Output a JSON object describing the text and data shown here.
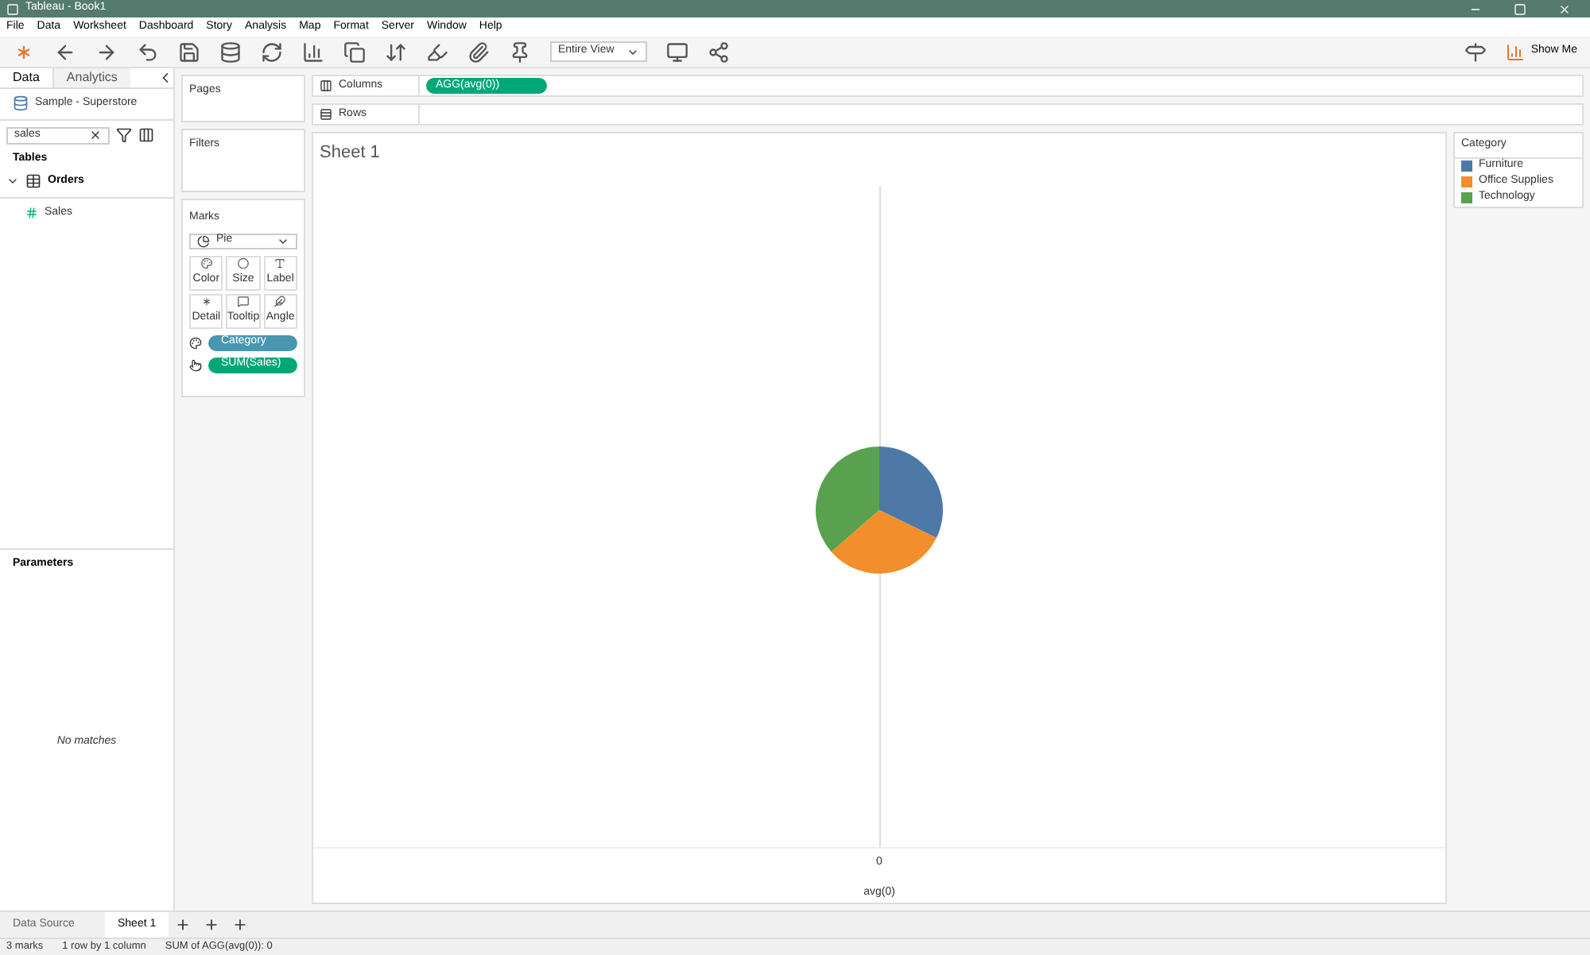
{
  "window": {
    "title": "Tableau - Book1"
  },
  "menu": [
    "File",
    "Data",
    "Worksheet",
    "Dashboard",
    "Story",
    "Analysis",
    "Map",
    "Format",
    "Server",
    "Window",
    "Help"
  ],
  "toolbar": {
    "fit": "Entire View",
    "show_me": "Show Me"
  },
  "side_tabs": [
    {
      "label": "Data",
      "selected": true
    },
    {
      "label": "Analytics",
      "selected": false
    }
  ],
  "data_source": "Sample - Superstore",
  "search": {
    "value": "sales"
  },
  "tables_heading": "Tables",
  "table": {
    "name": "Orders",
    "expanded": true,
    "fields": [
      "Sales"
    ]
  },
  "parameters": {
    "heading": "Parameters",
    "empty": "No matches"
  },
  "pages": "Pages",
  "filters": "Filters",
  "marks": {
    "heading": "Marks",
    "type": "Pie",
    "buttons": [
      "Color",
      "Size",
      "Label",
      "Detail",
      "Tooltip",
      "Angle"
    ],
    "pills": [
      {
        "kind": "color",
        "label": "Category"
      },
      {
        "kind": "angle",
        "label": "SUM(Sales)"
      }
    ]
  },
  "shelves": [
    {
      "kind": "columns",
      "label": "Columns",
      "pill": "AGG(avg(0))"
    },
    {
      "kind": "rows",
      "label": "Rows"
    }
  ],
  "sheet_title": "Sheet 1",
  "axis": {
    "tick": "0",
    "title": "avg(0)"
  },
  "legend": {
    "title": "Category",
    "items": [
      {
        "label": "Furniture",
        "color": "#4e79a7"
      },
      {
        "label": "Office Supplies",
        "color": "#f28e2b"
      },
      {
        "label": "Technology",
        "color": "#59a14f"
      }
    ]
  },
  "bottom_tabs": [
    {
      "label": "Data Source",
      "selected": false
    },
    {
      "label": "Sheet 1",
      "selected": true
    }
  ],
  "status": [
    "3 marks",
    "1 row by 1 column",
    "SUM of AGG(avg(0)): 0"
  ]
}
